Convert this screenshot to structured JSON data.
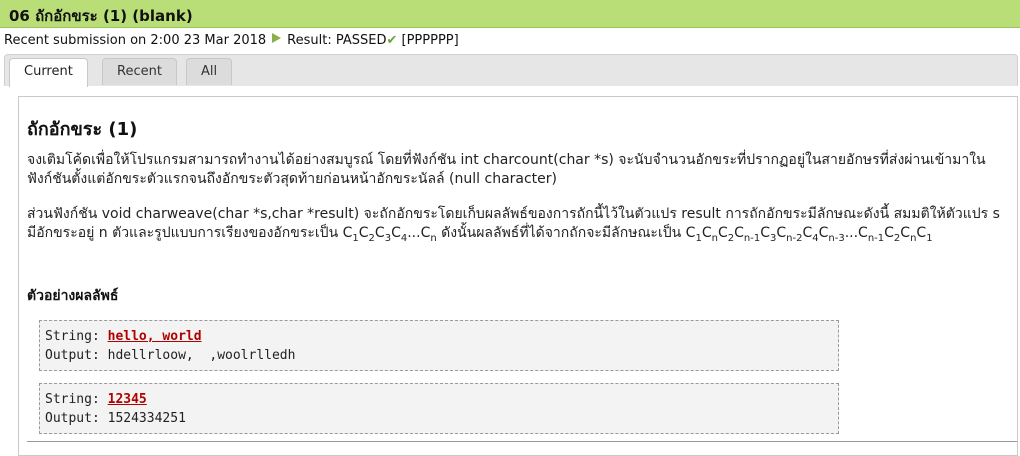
{
  "header": {
    "title": "06 ถักอักขระ (1) (blank)"
  },
  "status": {
    "submission": "Recent submission on 2:00 23 Mar 2018",
    "result": "Result: PASSED",
    "result_detail": "[PPPPPP]"
  },
  "tabs": [
    {
      "label": "Current"
    },
    {
      "label": "Recent"
    },
    {
      "label": "All"
    }
  ],
  "problem": {
    "heading": "ถักอักขระ (1)",
    "para1": "จงเติมโค้ดเพื่อให้โปรแกรมสามารถทำงานได้อย่างสมบูรณ์ โดยที่ฟังก์ชัน int charcount(char *s) จะนับจำนวนอักขระที่ปรากฏอยู่ในสายอักษรที่ส่งผ่านเข้ามาในฟังก์ชันตั้งแต่อักขระตัวแรกจนถึงอักขระตัวสุดท้ายก่อนหน้าอักขระนัลล์ (null character)",
    "para2": "ส่วนฟังก์ชัน void charweave(char *s,char *result) จะถักอักขระโดยเก็บผลลัพธ์ของการถักนี้ไว้ในตัวแปร result การถักอักขระมีลักษณะดังนี้ สมมติให้ตัวแปร s มีอักขระอยู่ n ตัวและรูปแบบการเรียงของอักขระเป็น ",
    "para2b": " ดังนั้นผลลัพธ์ที่ได้จากถักจะมีลักษณะเป็น ",
    "examples_heading": "ตัวอย่างผลลัพธ์",
    "examples": [
      {
        "string_label": "String:",
        "string_value": "hello, world",
        "output_label": "Output:",
        "output_value": "hdellrloow,  ,woolrlledh"
      },
      {
        "string_label": "String:",
        "string_value": "12345",
        "output_label": "Output:",
        "output_value": "1524334251"
      }
    ]
  }
}
